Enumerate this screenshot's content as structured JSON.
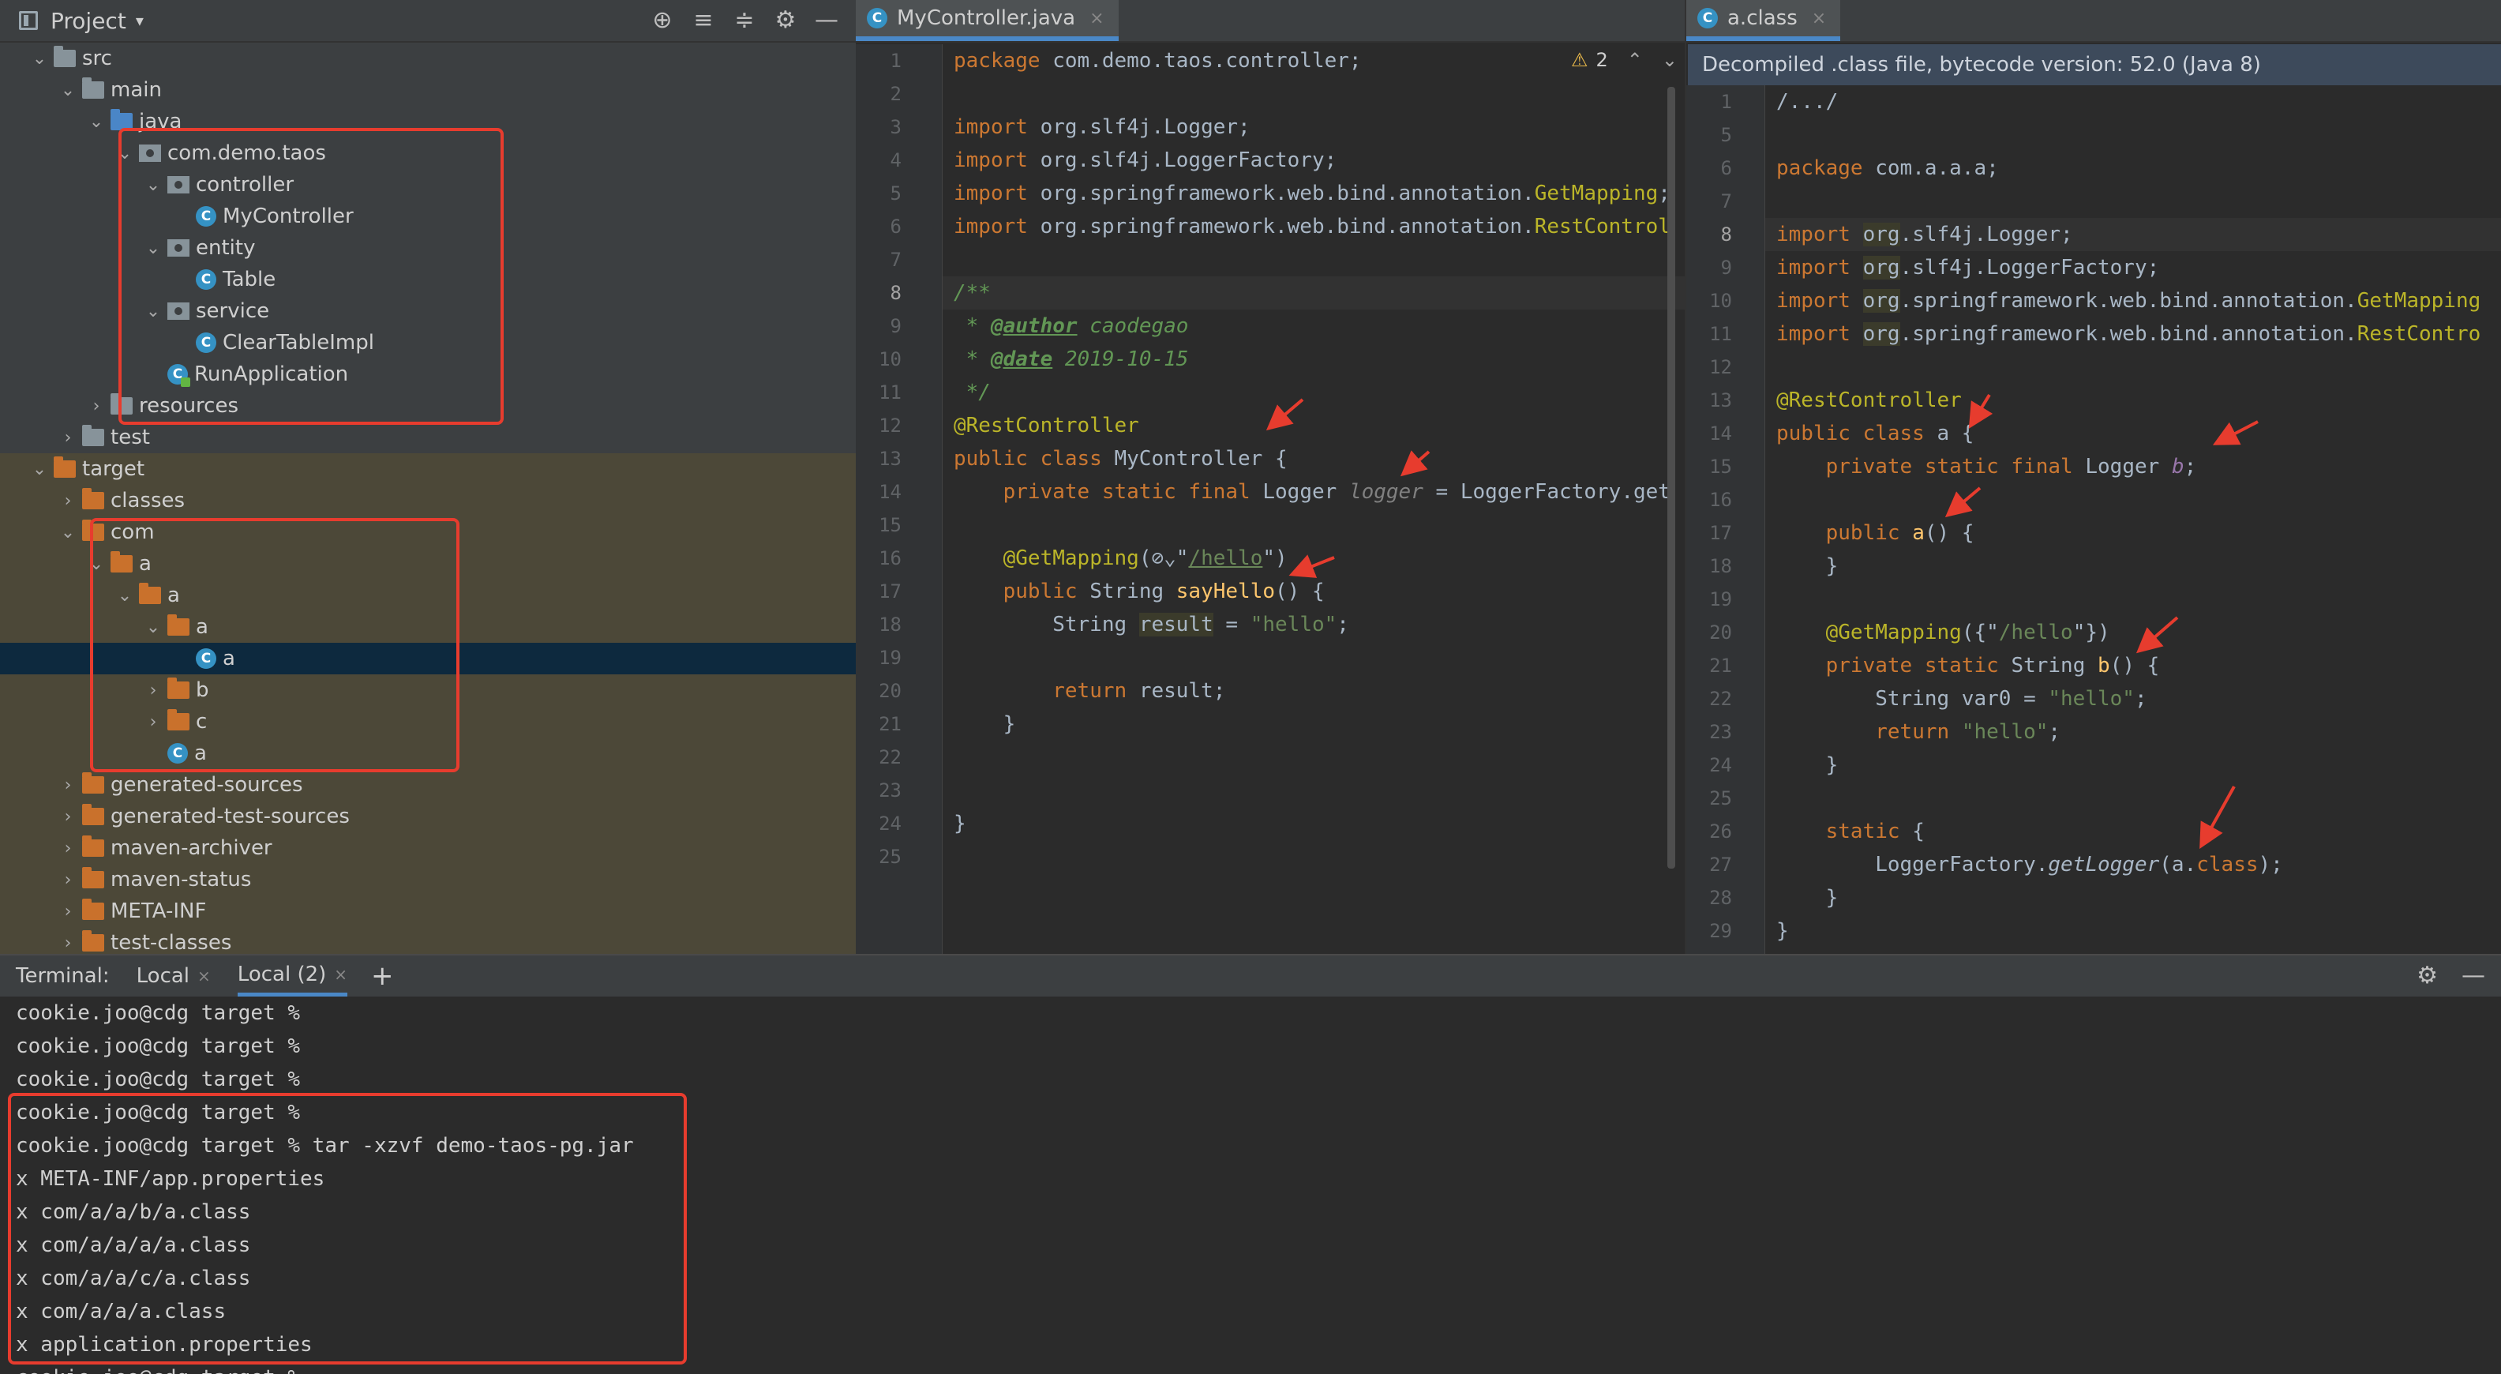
{
  "project": {
    "title": "Project",
    "caret": "▾",
    "tools": [
      "⊕",
      "≡",
      "≑",
      "⚙",
      "—"
    ],
    "tree": [
      {
        "label": "src",
        "depth": 1,
        "open": true,
        "icon": "folder"
      },
      {
        "label": "main",
        "depth": 2,
        "open": true,
        "icon": "folder"
      },
      {
        "label": "java",
        "depth": 3,
        "open": true,
        "icon": "folder-blue"
      },
      {
        "label": "com.demo.taos",
        "depth": 4,
        "open": true,
        "icon": "package"
      },
      {
        "label": "controller",
        "depth": 5,
        "open": true,
        "icon": "package"
      },
      {
        "label": "MyController",
        "depth": 6,
        "icon": "class"
      },
      {
        "label": "entity",
        "depth": 5,
        "open": true,
        "icon": "package"
      },
      {
        "label": "Table",
        "depth": 6,
        "icon": "class"
      },
      {
        "label": "service",
        "depth": 5,
        "open": true,
        "icon": "package"
      },
      {
        "label": "ClearTableImpl",
        "depth": 6,
        "icon": "class"
      },
      {
        "label": "RunApplication",
        "depth": 5,
        "icon": "class-spring"
      },
      {
        "label": "resources",
        "depth": 3,
        "open": false,
        "icon": "folder"
      },
      {
        "label": "test",
        "depth": 2,
        "open": false,
        "icon": "folder"
      },
      {
        "label": "target",
        "depth": 1,
        "open": true,
        "icon": "folder-orange",
        "shade": true
      },
      {
        "label": "classes",
        "depth": 2,
        "open": false,
        "icon": "folder-orange",
        "shade": true
      },
      {
        "label": "com",
        "depth": 2,
        "open": true,
        "icon": "folder-orange",
        "shade": true
      },
      {
        "label": "a",
        "depth": 3,
        "open": true,
        "icon": "folder-orange",
        "shade": true
      },
      {
        "label": "a",
        "depth": 4,
        "open": true,
        "icon": "folder-orange",
        "shade": true
      },
      {
        "label": "a",
        "depth": 5,
        "open": true,
        "icon": "folder-orange",
        "shade": true
      },
      {
        "label": "a",
        "depth": 6,
        "icon": "class",
        "selected": true
      },
      {
        "label": "b",
        "depth": 5,
        "open": false,
        "icon": "folder-orange",
        "shade": true
      },
      {
        "label": "c",
        "depth": 5,
        "open": false,
        "icon": "folder-orange",
        "shade": true
      },
      {
        "label": "a",
        "depth": 5,
        "icon": "class",
        "shade": true
      },
      {
        "label": "generated-sources",
        "depth": 2,
        "open": false,
        "icon": "folder-orange",
        "shade": true
      },
      {
        "label": "generated-test-sources",
        "depth": 2,
        "open": false,
        "icon": "folder-orange",
        "shade": true
      },
      {
        "label": "maven-archiver",
        "depth": 2,
        "open": false,
        "icon": "folder-orange",
        "shade": true
      },
      {
        "label": "maven-status",
        "depth": 2,
        "open": false,
        "icon": "folder-orange",
        "shade": true
      },
      {
        "label": "META-INF",
        "depth": 2,
        "open": false,
        "icon": "folder-orange",
        "shade": true
      },
      {
        "label": "test-classes",
        "depth": 2,
        "open": false,
        "icon": "folder-orange",
        "shade": true
      }
    ]
  },
  "editor_left": {
    "tab": {
      "label": "MyController.java",
      "icon_letter": "C",
      "close": "×"
    },
    "warnings": {
      "count": "2",
      "up": "⌃",
      "down": "⌄"
    },
    "current_line": 8,
    "lines": [
      {
        "n": "1",
        "tokens": [
          [
            "kw",
            "package "
          ],
          [
            "",
            "com.demo.taos.controller;"
          ]
        ]
      },
      {
        "n": "2",
        "tokens": []
      },
      {
        "n": "3",
        "tokens": [
          [
            "kw",
            "import "
          ],
          [
            "",
            "org.slf4j.Logger;"
          ]
        ]
      },
      {
        "n": "4",
        "tokens": [
          [
            "kw",
            "import "
          ],
          [
            "",
            "org.slf4j.LoggerFactory;"
          ]
        ]
      },
      {
        "n": "5",
        "tokens": [
          [
            "kw",
            "import "
          ],
          [
            "",
            "org.springframework.web.bind.annotation."
          ],
          [
            "ann",
            "GetMapping"
          ],
          [
            "",
            ";"
          ]
        ]
      },
      {
        "n": "6",
        "tokens": [
          [
            "kw",
            "import "
          ],
          [
            "",
            "org.springframework.web.bind.annotation."
          ],
          [
            "ann",
            "RestControl"
          ]
        ]
      },
      {
        "n": "7",
        "tokens": []
      },
      {
        "n": "8",
        "tokens": [
          [
            "cm",
            "/**"
          ]
        ]
      },
      {
        "n": "9",
        "tokens": [
          [
            "cm",
            " * "
          ],
          [
            "cmtag",
            "@author"
          ],
          [
            "cm",
            " caodegao"
          ]
        ]
      },
      {
        "n": "10",
        "tokens": [
          [
            "cm",
            " * "
          ],
          [
            "cmtag",
            "@date"
          ],
          [
            "cm",
            " 2019-10-15"
          ]
        ]
      },
      {
        "n": "11",
        "tokens": [
          [
            "cm",
            " */"
          ]
        ]
      },
      {
        "n": "12",
        "tokens": [
          [
            "ann",
            "@RestController"
          ]
        ]
      },
      {
        "n": "13",
        "tokens": [
          [
            "kw",
            "public class "
          ],
          [
            "",
            "MyController {"
          ]
        ]
      },
      {
        "n": "14",
        "tokens": [
          [
            "",
            "    "
          ],
          [
            "kw",
            "private static final "
          ],
          [
            "",
            "Logger "
          ],
          [
            "unused",
            "logger"
          ],
          [
            "",
            " = LoggerFactory.get"
          ]
        ]
      },
      {
        "n": "15",
        "tokens": []
      },
      {
        "n": "16",
        "tokens": [
          [
            "",
            "    "
          ],
          [
            "ann",
            "@GetMapping"
          ],
          [
            "",
            "(⊘⌄\""
          ],
          [
            "link",
            "/hello"
          ],
          [
            "",
            "\")"
          ]
        ]
      },
      {
        "n": "17",
        "tokens": [
          [
            "",
            "    "
          ],
          [
            "kw",
            "public "
          ],
          [
            "",
            "String "
          ],
          [
            "fn",
            "sayHello"
          ],
          [
            "",
            "() {"
          ]
        ]
      },
      {
        "n": "18",
        "tokens": [
          [
            "",
            "        String "
          ],
          [
            "hl",
            "result"
          ],
          [
            "",
            " = "
          ],
          [
            "str",
            "\"hello\""
          ],
          [
            "",
            ";"
          ]
        ]
      },
      {
        "n": "19",
        "tokens": []
      },
      {
        "n": "20",
        "tokens": [
          [
            "",
            "        "
          ],
          [
            "kw",
            "return "
          ],
          [
            "",
            "result;"
          ]
        ]
      },
      {
        "n": "21",
        "tokens": [
          [
            "",
            "    }"
          ]
        ]
      },
      {
        "n": "22",
        "tokens": []
      },
      {
        "n": "23",
        "tokens": []
      },
      {
        "n": "24",
        "tokens": [
          [
            "",
            "}"
          ]
        ]
      },
      {
        "n": "25",
        "tokens": []
      }
    ]
  },
  "editor_right": {
    "tab": {
      "label": "a.class",
      "icon_letter": "C",
      "close": "×"
    },
    "banner": "Decompiled .class file, bytecode version: 52.0 (Java 8)",
    "current_line": 8,
    "lines": [
      {
        "n": "1",
        "tokens": [
          [
            "",
            "/.../"
          ]
        ]
      },
      {
        "n": "5",
        "tokens": []
      },
      {
        "n": "6",
        "tokens": [
          [
            "kw",
            "package "
          ],
          [
            "",
            "com.a.a.a;"
          ]
        ]
      },
      {
        "n": "7",
        "tokens": []
      },
      {
        "n": "8",
        "tokens": [
          [
            "kw",
            "import "
          ],
          [
            "hl",
            "org"
          ],
          [
            "",
            ".slf4j.Logger;"
          ]
        ]
      },
      {
        "n": "9",
        "tokens": [
          [
            "kw",
            "import "
          ],
          [
            "hl",
            "org"
          ],
          [
            "",
            ".slf4j.LoggerFactory;"
          ]
        ]
      },
      {
        "n": "10",
        "tokens": [
          [
            "kw",
            "import "
          ],
          [
            "hl",
            "org"
          ],
          [
            "",
            ".springframework.web.bind.annotation."
          ],
          [
            "ann",
            "GetMapping"
          ]
        ]
      },
      {
        "n": "11",
        "tokens": [
          [
            "kw",
            "import "
          ],
          [
            "hl",
            "org"
          ],
          [
            "",
            ".springframework.web.bind.annotation."
          ],
          [
            "ann",
            "RestContro"
          ]
        ]
      },
      {
        "n": "12",
        "tokens": []
      },
      {
        "n": "13",
        "tokens": [
          [
            "ann",
            "@RestController"
          ]
        ]
      },
      {
        "n": "14",
        "tokens": [
          [
            "kw",
            "public class "
          ],
          [
            "",
            "a {"
          ]
        ]
      },
      {
        "n": "15",
        "tokens": [
          [
            "",
            "    "
          ],
          [
            "kw",
            "private static final "
          ],
          [
            "",
            "Logger "
          ],
          [
            "fld",
            "b"
          ],
          [
            "",
            ";"
          ]
        ]
      },
      {
        "n": "16",
        "tokens": []
      },
      {
        "n": "17",
        "tokens": [
          [
            "",
            "    "
          ],
          [
            "kw",
            "public "
          ],
          [
            "fn",
            "a"
          ],
          [
            "",
            "() {"
          ]
        ]
      },
      {
        "n": "18",
        "tokens": [
          [
            "",
            "    }"
          ]
        ]
      },
      {
        "n": "19",
        "tokens": []
      },
      {
        "n": "20",
        "tokens": [
          [
            "",
            "    "
          ],
          [
            "ann",
            "@GetMapping"
          ],
          [
            "",
            "({\""
          ],
          [
            "str",
            "/hello"
          ],
          [
            "",
            "\"})"
          ]
        ]
      },
      {
        "n": "21",
        "tokens": [
          [
            "",
            "    "
          ],
          [
            "kw",
            "private static "
          ],
          [
            "",
            "String "
          ],
          [
            "fn",
            "b"
          ],
          [
            "",
            "() {"
          ]
        ]
      },
      {
        "n": "22",
        "tokens": [
          [
            "",
            "        String var0 = "
          ],
          [
            "str",
            "\"hello\""
          ],
          [
            "",
            ";"
          ]
        ]
      },
      {
        "n": "23",
        "tokens": [
          [
            "",
            "        "
          ],
          [
            "kw",
            "return "
          ],
          [
            "str",
            "\"hello\""
          ],
          [
            "",
            ";"
          ]
        ]
      },
      {
        "n": "24",
        "tokens": [
          [
            "",
            "    }"
          ]
        ]
      },
      {
        "n": "25",
        "tokens": []
      },
      {
        "n": "26",
        "tokens": [
          [
            "",
            "    "
          ],
          [
            "kw",
            "static "
          ],
          [
            "",
            "{"
          ]
        ]
      },
      {
        "n": "27",
        "tokens": [
          [
            "",
            "        LoggerFactory."
          ],
          [
            "ital",
            "getLogger"
          ],
          [
            "",
            "(a."
          ],
          [
            "kw",
            "class"
          ],
          [
            "",
            ");"
          ]
        ]
      },
      {
        "n": "28",
        "tokens": [
          [
            "",
            "    }"
          ]
        ]
      },
      {
        "n": "29",
        "tokens": [
          [
            "",
            "}"
          ]
        ]
      }
    ]
  },
  "terminal": {
    "label": "Terminal:",
    "tabs": [
      {
        "label": "Local",
        "close": "×"
      },
      {
        "label": "Local (2)",
        "close": "×",
        "active": true
      }
    ],
    "plus": "+",
    "tools": [
      "⚙",
      "—"
    ],
    "lines": [
      "cookie.joo@cdg target %",
      "cookie.joo@cdg target %",
      "cookie.joo@cdg target %",
      "cookie.joo@cdg target %",
      "cookie.joo@cdg target % tar -xzvf demo-taos-pg.jar",
      "x META-INF/app.properties",
      "x com/a/a/b/a.class",
      "x com/a/a/a/a.class",
      "x com/a/a/c/a.class",
      "x com/a/a/a.class",
      "x application.properties",
      "cookie.joo@cdg target %"
    ]
  }
}
